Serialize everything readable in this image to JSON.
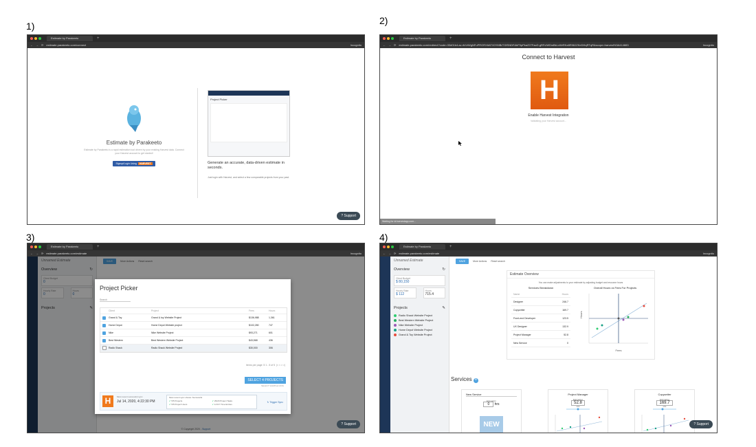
{
  "steps": [
    "1)",
    "2)",
    "3)",
    "4)"
  ],
  "browser": {
    "tab_title": "Estimate by Parakeeto",
    "incognito": "Incognito",
    "urls": [
      "estimate.parakeeto.com/connect",
      "estimate.parakeeto.com/redirect?code=33d01b4.ac.rfvVrWgNFuPRORX6ATX0YMBrTGfSNDF&bF9pPkaZ27FaoD.gRFcIWDwBkLxWrRKa5R08JZKeDHqRTqR&scope=harvest%3A414883",
      "estimate.parakeeto.com/estimate",
      "estimate.parakeeto.com/estimate"
    ]
  },
  "support_label": "Support",
  "shot1": {
    "title": "Estimate by Parakeeto",
    "description": "Estimate by Parakeeto is a rapid estimation tool driven by your existing Harvest data. Connect your Harvest account to get started!",
    "signup_label": "Signup/Login Using",
    "signup_brand": "HARVEST",
    "preview_title": "Project Picker",
    "headline": "Generate an accurate, data-driven estimate in seconds.",
    "subtext": "Just login with Harvest, and select a few comparable projects from your past."
  },
  "shot2": {
    "title": "Connect to Harvest",
    "logo_letter": "H",
    "enable": "Enable Harvest Integration",
    "validating": "Validating your Harvest account...",
    "status": "Waiting for id.harvestapp.com..."
  },
  "app": {
    "estimate_name": "Unnamed Estimate",
    "save": "SAVE",
    "more_actions": "More Actions",
    "reset": "Reset search",
    "overview": "Overview",
    "client_budget": "Client Budget",
    "hourly_rate": "Hourly Rate",
    "hours": "Hours",
    "projects": "Projects",
    "copyright": "© Copyright 2020 -",
    "copyright_link": "Support"
  },
  "shot3": {
    "budget_value": "0",
    "rate_value": "0",
    "hours_value": "0",
    "modal_title": "Project Picker",
    "search": "Search",
    "columns": [
      "Client",
      "Project",
      "Fees",
      "Hours"
    ],
    "rows": [
      {
        "client": "Grand & Toy",
        "project": "Grand & toy Website Project",
        "fees": "$136,988",
        "hours": "1,361"
      },
      {
        "client": "Home Depot",
        "project": "Home Depot Website project",
        "fees": "$102,280",
        "hours": "747"
      },
      {
        "client": "Nike",
        "project": "Nike Website Project",
        "fees": "$93,271",
        "hours": "601"
      },
      {
        "client": "Best Western",
        "project": "Best Western Website Project",
        "fees": "$43,568",
        "hours": "436"
      },
      {
        "client": "Radio Shack",
        "project": "Radio Shack Website Project",
        "fees": "$30,000",
        "hours": "306"
      }
    ],
    "pager": "Items per page: 5     1 - 5 of 5",
    "select_button": "SELECT 4 PROJECTS",
    "select_sample": "SELECT SAMPLE DATA",
    "last_sync_label": "Most recent successful sync",
    "last_sync": "Jul 14, 2020, 4:22:30 PM",
    "sync_stats_label": "Most recent sync shows: Successful",
    "sync_stats": [
      "5/5 Projects",
      "5/5 Project Users",
      "29/29 Project Tasks",
      "1/1/17 Time Entries"
    ],
    "trigger": "Trigger Sync",
    "partial_section": "Se"
  },
  "shot4": {
    "budget_value": "$ 80,150",
    "rate_value": "$ 112",
    "hours_value": "715.4",
    "project_list": [
      {
        "name": "Radio Shack Website Project",
        "color": "#2ecc71"
      },
      {
        "name": "Best Western Website Project",
        "color": "#27ae60"
      },
      {
        "name": "Nike Website Project",
        "color": "#9b59b6"
      },
      {
        "name": "Home Depot Website Project",
        "color": "#16a085"
      },
      {
        "name": "Grand & Toy Website Project",
        "color": "#e74c3c"
      }
    ],
    "eo_title": "Estimate Overview",
    "eo_note": "You can make adjustments to your estimate by adjusting budget and resource hours",
    "breakdown_title": "Services Breakdown",
    "breakdown_cols": [
      "Name",
      "Hours"
    ],
    "breakdown": [
      {
        "name": "Designer",
        "hours": "246.7"
      },
      {
        "name": "Copywriter",
        "hours": "169.7"
      },
      {
        "name": "Front-end Developer",
        "hours": "123.5"
      },
      {
        "name": "UX Designer",
        "hours": "132.9"
      },
      {
        "name": "Project Manager",
        "hours": "52.8"
      },
      {
        "name": "New Service",
        "hours": "0"
      }
    ],
    "chart_title": "Overall Hours vs Fees For Projects",
    "chart_xlabel": "Fees",
    "chart_ylabel": "Hours",
    "services_title": "Services",
    "cards": [
      {
        "title": "New Service",
        "estimate_label": "Estimation",
        "value": "0",
        "unit": "hrs",
        "badge": "NEW"
      },
      {
        "title": "Project Manager",
        "estimate_label": "Estimating",
        "value": "52.8",
        "unit": "Hrs"
      },
      {
        "title": "Copywriter",
        "estimate_label": "Estimating",
        "value": "169.7",
        "unit": "Hrs"
      }
    ]
  },
  "colors": {
    "accent": "#4fa3e0",
    "harvest": "#f07a1d",
    "nav": "#1d3557"
  }
}
